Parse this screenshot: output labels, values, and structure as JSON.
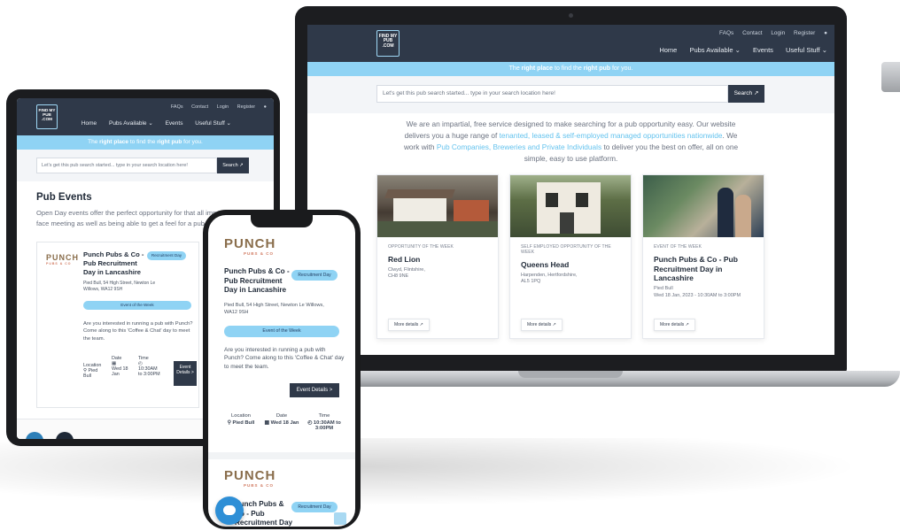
{
  "site": {
    "logo_text": "FIND MY PUB .COM",
    "util_links": [
      "FAQs",
      "Contact",
      "Login",
      "Register"
    ],
    "nav": {
      "home": "Home",
      "pubs": "Pubs Available ⌄",
      "events": "Events",
      "useful": "Useful Stuff ⌄"
    },
    "tagline": {
      "pre": "The ",
      "b1": "right place",
      "mid": " to find the ",
      "b2": "right pub",
      "post": " for you."
    },
    "search_placeholder": "Let's get this pub search started... type in your search location here!",
    "search_button": "Search ↗"
  },
  "laptop": {
    "intro": {
      "p1": "We are an impartial, free service designed to make searching for a pub opportunity easy. Our website delivers you a huge range of ",
      "l1": "tenanted, leased & self-employed managed opportunities nationwide",
      "p2": ". We work with ",
      "l2": "Pub Companies, Breweries and Private Individuals",
      "p3": " to deliver you the best on offer, all on one simple, easy to use platform."
    },
    "cards": [
      {
        "type": "OPPORTUNITY OF THE WEEK",
        "title": "Red Lion",
        "sub1": "Clwyd, Flintshire,",
        "sub2": "CH8 9NE",
        "more": "More details ↗"
      },
      {
        "type": "SELF EMPLOYED OPPORTUNITY OF THE WEEK",
        "title": "Queens Head",
        "sub1": "Harpenden, Hertfordshire,",
        "sub2": "AL5 1PQ",
        "more": "More details ↗"
      },
      {
        "type": "EVENT OF THE WEEK",
        "title": "Punch Pubs & Co - Pub Recruitment Day in Lancashire",
        "sub1": "Pied Bull",
        "sub2": "Wed 18 Jan, 2023 - 10:30AM to 3:00PM",
        "more": "More details ↗"
      }
    ]
  },
  "tablet": {
    "heading": "Pub Events",
    "desc": "Open Day events offer the perfect opportunity for that all important face to face meeting as well as being able to get a feel for a pub company.",
    "punch": "PUNCH",
    "punch_sub": "PUBS & CO",
    "ev_title": "Punch Pubs & Co - Pub Recruitment Day in Lancashire",
    "badge": "Recruitment Day",
    "addr": "Pied Bull, 54 High Street, Newton Le Willows, WA12 9SH",
    "eow": "Event of the Week",
    "ev_desc": "Are you interested in running a pub with Punch? Come along to this 'Coffee & Chat' day to meet the team.",
    "loc_label": "Location",
    "loc_val": "Pied Bull",
    "date_label": "Date",
    "date_val": "Wed 18 Jan",
    "time_label": "Time",
    "time_val": "10:30AM to 3:00PM",
    "btn": "Event Details >"
  },
  "phone": {
    "punch": "PUNCH",
    "punch_sub": "PUBS & CO",
    "ev_title": "Punch Pubs & Co - Pub Recruitment Day in Lancashire",
    "badge": "Recruitment Day",
    "addr": "Pied Bull, 54 High Street, Newton Le Willows, WA12 9SH",
    "eow": "Event of the Week",
    "ev_desc": "Are you interested in running a pub with Punch? Come along to this 'Coffee & Chat' day to meet the team.",
    "btn": "Event Details >",
    "loc_label": "Location",
    "loc_val": "Pied Bull",
    "date_label": "Date",
    "date_val": "Wed 18 Jan",
    "time_label": "Time",
    "time_val": "10:30AM to 3:00PM",
    "ev2_title": "Punch Pubs & Co - Pub Recruitment Day in Bristol"
  },
  "colors": {
    "navy": "#2f3949",
    "sky": "#8fd3f4",
    "link": "#65c3ee"
  }
}
